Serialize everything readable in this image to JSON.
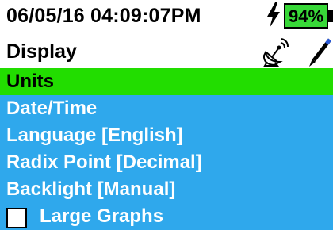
{
  "status": {
    "datetime": "06/05/16 04:09:07PM",
    "battery_percent": "94%",
    "charging_icon": "lightning-bolt-icon"
  },
  "header": {
    "title": "Display",
    "icons": [
      "satellite-dish-icon",
      "pen-icon"
    ]
  },
  "menu": {
    "items": [
      {
        "label": "Units",
        "selected": true
      },
      {
        "label": "Date/Time"
      },
      {
        "label": "Language [English]"
      },
      {
        "label": "Radix Point [Decimal]"
      },
      {
        "label": "Backlight [Manual]"
      },
      {
        "label": "Large Graphs",
        "checkbox": true,
        "checked": false
      }
    ]
  },
  "colors": {
    "menu_bg": "#2fa8ec",
    "selected_bg": "#22dd00",
    "battery_fill": "#38d838"
  }
}
